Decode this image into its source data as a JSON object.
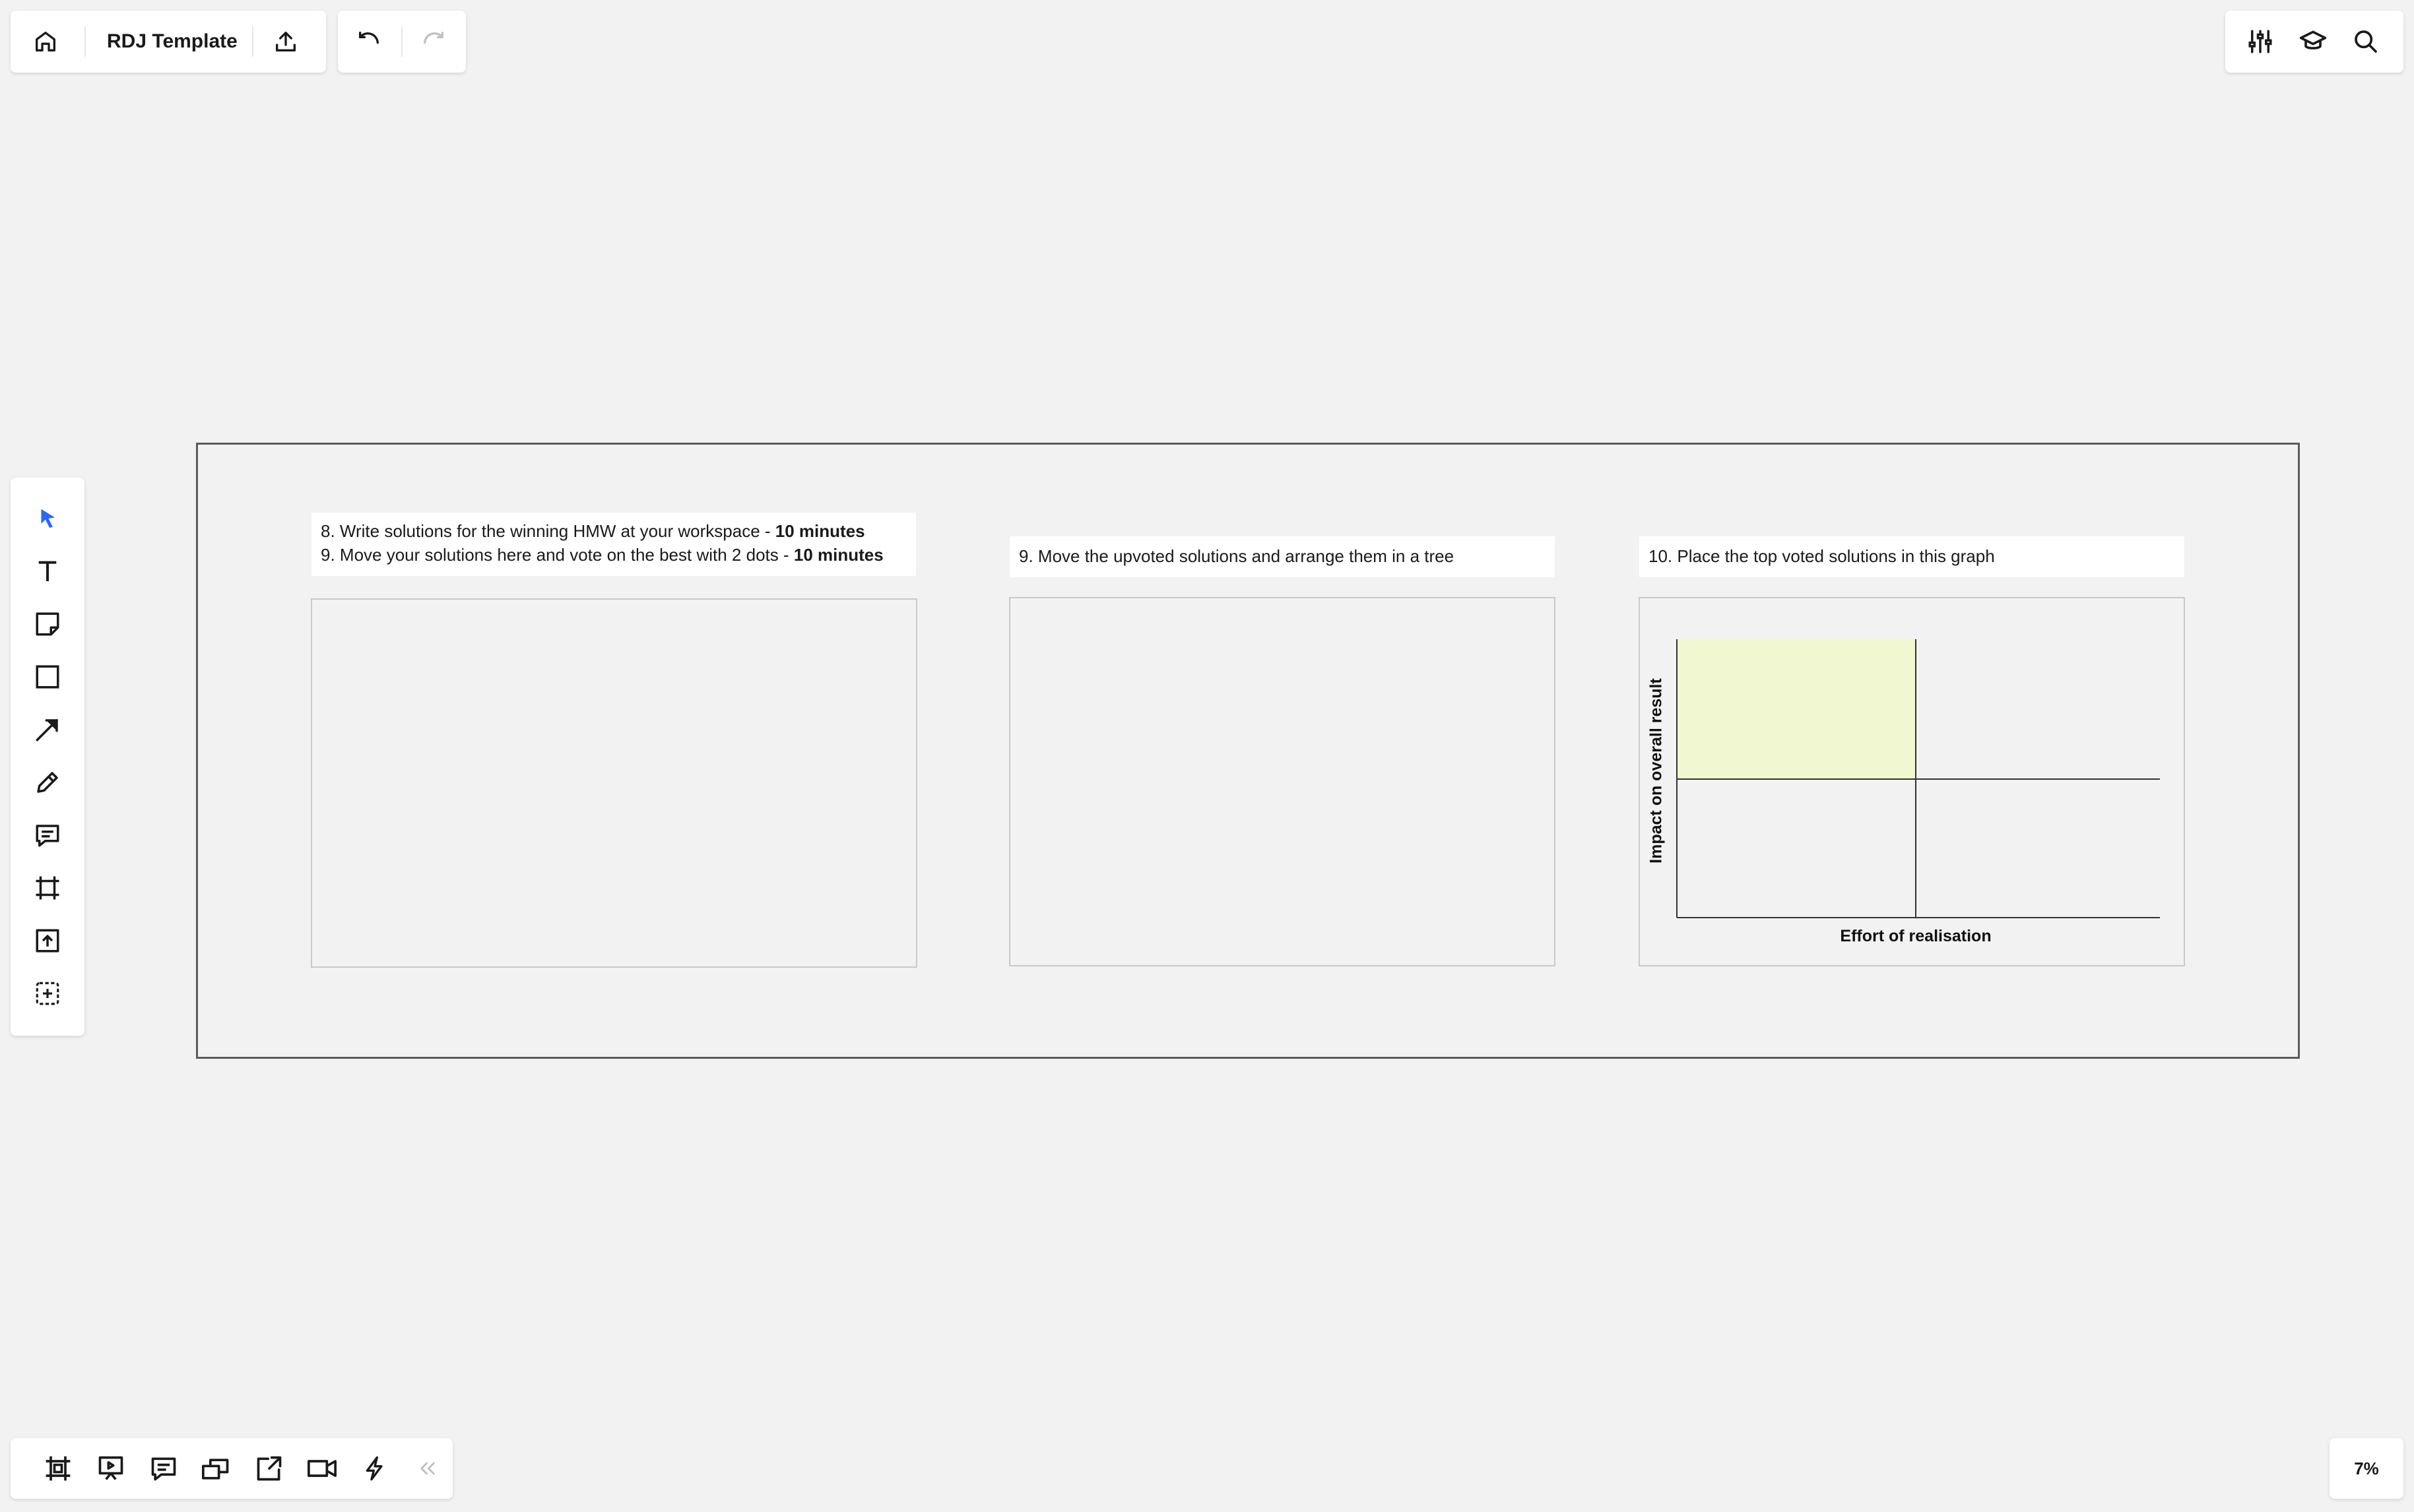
{
  "header": {
    "board_title": "RDJ Template",
    "icons": [
      "home-icon",
      "upload-icon",
      "undo-icon",
      "redo-icon"
    ]
  },
  "topright": {
    "icons": [
      "settings-sliders-icon",
      "learning-cap-icon",
      "search-icon"
    ]
  },
  "toolbar": {
    "tools": [
      "select-icon",
      "text-icon",
      "sticky-note-icon",
      "shape-icon",
      "arrow-icon",
      "pen-icon",
      "comment-icon",
      "frame-icon",
      "upload-icon",
      "more-tools-icon"
    ],
    "active": "select-icon"
  },
  "board": {
    "card1": {
      "line1_text": "8. Write solutions for the winning HMW at your workspace - ",
      "line1_bold": "10 minutes",
      "line2_text": "9. Move your solutions here and vote on the best with 2 dots - ",
      "line2_bold": "10 minutes"
    },
    "card2": {
      "text": "9. Move the upvoted solutions and arrange them in a tree"
    },
    "card3": {
      "text": "10. Place the top voted solutions in this graph"
    },
    "matrix": {
      "ylabel": "Impact on overall result",
      "xlabel": "Effort of realisation",
      "highlight_color": "#f1f7d0"
    }
  },
  "bottombar": {
    "icons": [
      "frames-icon",
      "presentation-icon",
      "comments-icon",
      "cards-icon",
      "share-screen-icon",
      "video-icon",
      "lightning-icon",
      "collapse-icon"
    ]
  },
  "zoom": {
    "level": "7%"
  }
}
